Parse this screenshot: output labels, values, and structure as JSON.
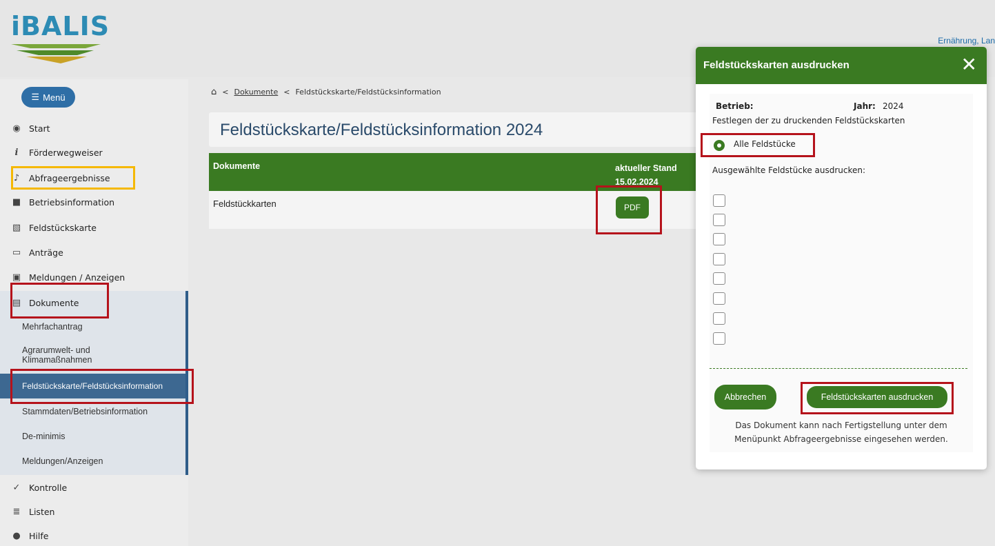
{
  "header": {
    "logo_text": "iBALIS",
    "user_text": "Ernährung, Lan"
  },
  "sidebar": {
    "menu_label": "Menü",
    "items": [
      {
        "label": "Start",
        "icon": "dashboard-icon"
      },
      {
        "label": "Förderwegweiser",
        "icon": "info-icon"
      },
      {
        "label": "Abfrageergebnisse",
        "icon": "bell-icon"
      },
      {
        "label": "Betriebsinformation",
        "icon": "building-icon"
      },
      {
        "label": "Feldstückskarte",
        "icon": "map-icon"
      },
      {
        "label": "Anträge",
        "icon": "clipboard-icon"
      },
      {
        "label": "Meldungen / Anzeigen",
        "icon": "monitor-icon"
      },
      {
        "label": "Dokumente",
        "icon": "document-icon"
      }
    ],
    "sub_items": [
      {
        "label": "Mehrfachantrag"
      },
      {
        "label": "Agrarumwelt- und Klimamaßnahmen"
      },
      {
        "label": "Feldstückskarte/Feldstücksinformation"
      },
      {
        "label": "Stammdaten/Betriebsinformation"
      },
      {
        "label": "De-minimis"
      },
      {
        "label": "Meldungen/Anzeigen"
      }
    ],
    "bottom_items": [
      {
        "label": "Kontrolle",
        "icon": "check-icon"
      },
      {
        "label": "Listen",
        "icon": "list-icon"
      },
      {
        "label": "Hilfe",
        "icon": "help-icon"
      }
    ]
  },
  "breadcrumb": {
    "sep": "<",
    "link": "Dokumente",
    "current": "Feldstückskarte/Feldstücksinformation"
  },
  "main": {
    "title": "Feldstückskarte/Feldstücksinformation 2024",
    "table": {
      "col1": "Dokumente",
      "col2_line1": "aktueller Stand",
      "col2_line2": "15.02.2024",
      "row_label": "Feldstückkarten",
      "pdf_label": "PDF"
    }
  },
  "modal": {
    "title": "Feldstückskarten ausdrucken",
    "close": "✕",
    "betrieb_label": "Betrieb:",
    "jahr_label": "Jahr:",
    "jahr_value": "2024",
    "festlegen": "Festlegen der zu druckenden Feldstückskarten",
    "radio_label": "Alle Feldstücke",
    "selected_label": "Ausgewählte Feldstücke ausdrucken:",
    "checkbox_count": 8,
    "cancel_label": "Abbrechen",
    "print_label": "Feldstückskarten ausdrucken",
    "note_line1": "Das Dokument kann nach Fertigstellung unter dem",
    "note_line2": "Menüpunkt Abfrageergebnisse eingesehen werden."
  },
  "colors": {
    "green": "#3a7a22",
    "blue": "#2e6ea6",
    "highlight_red": "#b5121b",
    "highlight_yellow": "#f5b800"
  }
}
